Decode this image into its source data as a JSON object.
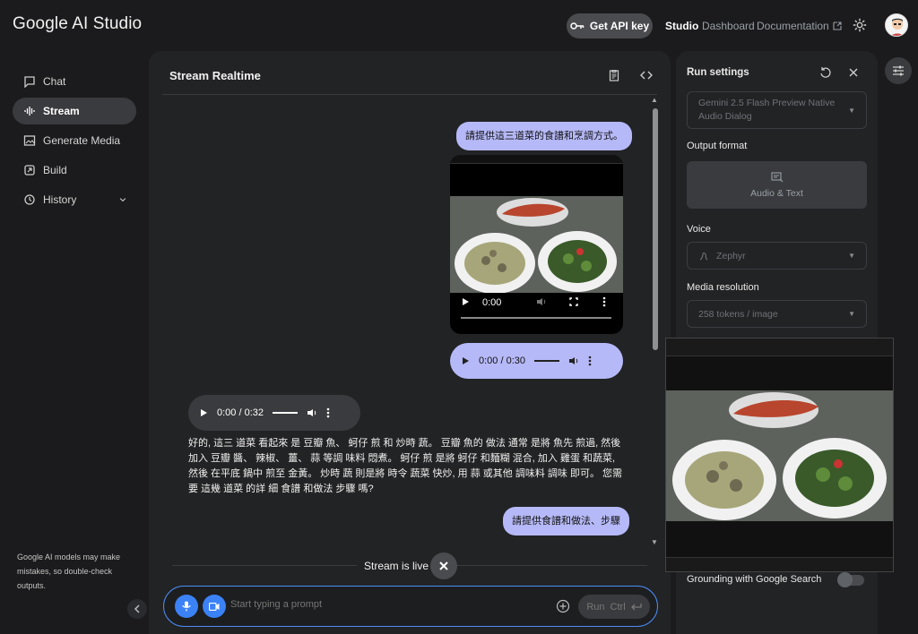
{
  "app": {
    "title": "Google AI Studio"
  },
  "header": {
    "api_key_label": "Get API key",
    "nav": [
      {
        "label": "Studio"
      },
      {
        "label": "Dashboard"
      },
      {
        "label": "Documentation"
      }
    ]
  },
  "sidebar": {
    "items": [
      {
        "label": "Chat",
        "icon": "chat-icon"
      },
      {
        "label": "Stream",
        "icon": "waveform-icon"
      },
      {
        "label": "Generate Media",
        "icon": "image-icon"
      },
      {
        "label": "Build",
        "icon": "build-icon"
      },
      {
        "label": "History",
        "icon": "history-icon"
      }
    ],
    "disclaimer": "Google AI models may make mistakes, so double-check outputs."
  },
  "stream": {
    "title": "Stream Realtime",
    "messages": {
      "user1": "請提供這三道菜的食譜和烹調方式。",
      "video_time": "0:00",
      "user_audio_time": "0:00 / 0:30",
      "model_audio_time": "0:00 / 0:32",
      "model_text": "好的, 這三 道菜 看起來 是 豆瓣 魚、 蚵仔 煎 和 炒時 蔬。 豆瓣 魚的 做法 通常 是將 魚先 煎過, 然後 加入 豆瓣 醬、 辣椒、 薑、 蒜 等調 味料 悶煮。 蚵仔 煎 是將 蚵仔 和麵糊 混合, 加入 雞蛋 和蔬菜, 然後 在平底 鍋中 煎至 金黃。 炒時 蔬 則是將 時令 蔬菜 快炒, 用 蒜 或其他 調味料 調味 即可。 您需要 這幾 道菜 的詳 細 食譜 和做法 步驟 嗎?",
      "user2": "請提供食譜和做法、步驟"
    },
    "live_label": "Stream is live",
    "prompt": {
      "placeholder": "Start typing a prompt",
      "run_label": "Run",
      "shortcut": "Ctrl"
    }
  },
  "run_settings": {
    "title": "Run settings",
    "model": "Gemini 2.5 Flash Preview Native Audio Dialog",
    "output_format_label": "Output format",
    "output_format_value": "Audio & Text",
    "voice_label": "Voice",
    "voice_value": "Zephyr",
    "media_resolution_label": "Media resolution",
    "media_resolution_value": "258 tokens / image",
    "grounding_label": "Grounding with Google Search",
    "grounding_enabled": false
  },
  "colors": {
    "accent": "#3b82f6",
    "user_bubble": "#b6b9f7",
    "audio_pill": "#b6b9f7",
    "model_audio_pill": "#3a3b3e"
  }
}
